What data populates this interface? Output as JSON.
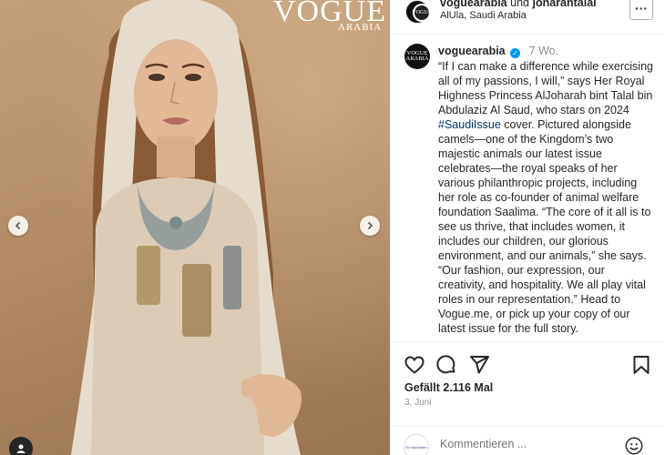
{
  "media": {
    "magazine_title": "VOGUE",
    "magazine_subtitle": "ARABIA",
    "prev_icon": "chevron-left-icon",
    "next_icon": "chevron-right-icon",
    "tag_icon": "user-tag-icon"
  },
  "header": {
    "avatar_text": "VOGUE",
    "user1": "voguearabia",
    "joiner": "und",
    "user2": "jonarantalal",
    "location": "AlUla, Saudi Arabia",
    "more_label": "···"
  },
  "caption": {
    "avatar_text": "VOGUE ARABIA",
    "username": "voguearabia",
    "verified_icon": "verified-badge-icon",
    "time": "7 Wo.",
    "text_before": "“If I can make a difference while exercising all of my passions, I will,” says Her Royal Highness Princess AlJoharah bint Talal bin Abdulaziz Al Saud, who stars on 2024 ",
    "hashtag": "#SaudiIssue",
    "text_after": " cover. Pictured alongside camels—one of the Kingdom’s two majestic animals our latest issue celebrates—the royal speaks of her various philanthropic projects, including her role as co-founder of animal welfare foundation Saalima. “The core of it all is to see us thrive, that includes women, it includes our children, our glorious environment, and our animals,” she says. “Our fashion, our expression, our creativity, and hospitality. We all play vital roles in our representation.” Head to Vogue.me, or pick up your copy of our latest issue for the full story."
  },
  "actions": {
    "like_icon": "heart-icon",
    "comment_icon": "comment-icon",
    "share_icon": "send-icon",
    "save_icon": "bookmark-icon",
    "likes": "Gefällt 2.116 Mal",
    "date": "3. Juni"
  },
  "comment": {
    "avatar_text": "Ihr Nachbarn",
    "placeholder": "Kommentieren ...",
    "emoji_icon": "emoji-icon"
  }
}
